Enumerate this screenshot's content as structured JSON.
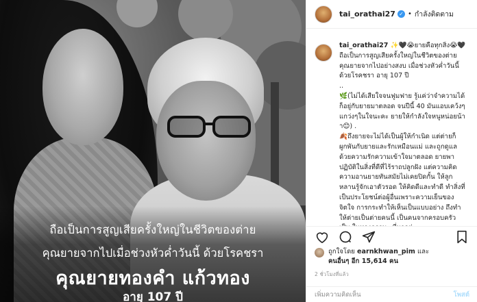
{
  "photo": {
    "caption_line1": "ถือเป็นการสูญเสียครั้งใหญ่ในชีวิตของต่าย",
    "caption_line2": "คุณยายจากไปเมื่อช่วงหัวค่ำวันนี้ ด้วยโรคชรา",
    "caption_line3": "คุณยายทองคำ แก้วทอง",
    "caption_line4": "อายุ 107 ปี"
  },
  "header": {
    "username": "tai_orathai27",
    "verified_mark": "✓",
    "separator": "•",
    "follow_state": "กำลังติดตาม"
  },
  "comment": {
    "username": "tai_orathai27",
    "text": "✨🖤😭ยายคือทุกสิ่ง😭🖤 ถือเป็นการสูญเสียครั้งใหญ่ในชีวิตของต่าย คุณยายจากไปอย่างสงบ เมื่อช่วงหัวค่ำวันนี้ ด้วยโรคชรา อายุ 107 ปี\n..\n🌿(ไม่ได้เสียใจจนฟูมฟาย รู้แค่ว่าจำความได้ก็อยู่กับยายมาตลอด จนปีนี้ 40 มันแอบเคว้งๆแกว่งๆในใจนะคะ ยายให้กำลังใจหนูหน่อยน้าา😊) .\n🍂ถึงยายจะไม่ได้เป็นผู้ให้กำเนิด แต่ต่ายก็ผูกพันกับยายและรักเหมือนแม่ และถูกดูแลด้วยความรักความเข้าใจมาตลอด ยายพาปฏิบัติในสิ่งที่ดีที่ไร้ราถปลูกฝัง แต่ความคิดความอานยายทันสมัยไม่เคยปิดกั้น ให้ลูกหลานรู้จักเอาตัวรอด ให้คิดดีและทำดี ทำสิ่งที่เป็นประโยชน์ต่อผู้อื่นเพราะความเย็นของจิตใจ การกระทำให้เห็นเป็นแบบอย่าง ถึงทำให้ต่ายเป็นต่ายคนนี้ เป็นคนจากครอบครัวเป็น ในทางธรรมะ ที่มาอยู่"
  },
  "actions": {
    "like_icon": "heart-icon",
    "comment_icon": "comment-icon",
    "share_icon": "share-icon",
    "save_icon": "bookmark-icon"
  },
  "likes": {
    "prefix": "ถูกใจโดย",
    "liker": "earnkhwan_pim",
    "and": "และ",
    "others": "คนอื่นๆ อีก 15,614 คน"
  },
  "time": "2 ชั่วโมงที่แล้ว",
  "add_comment": {
    "placeholder": "เพิ่มความคิดเห็น",
    "post_label": "โพสต์"
  }
}
